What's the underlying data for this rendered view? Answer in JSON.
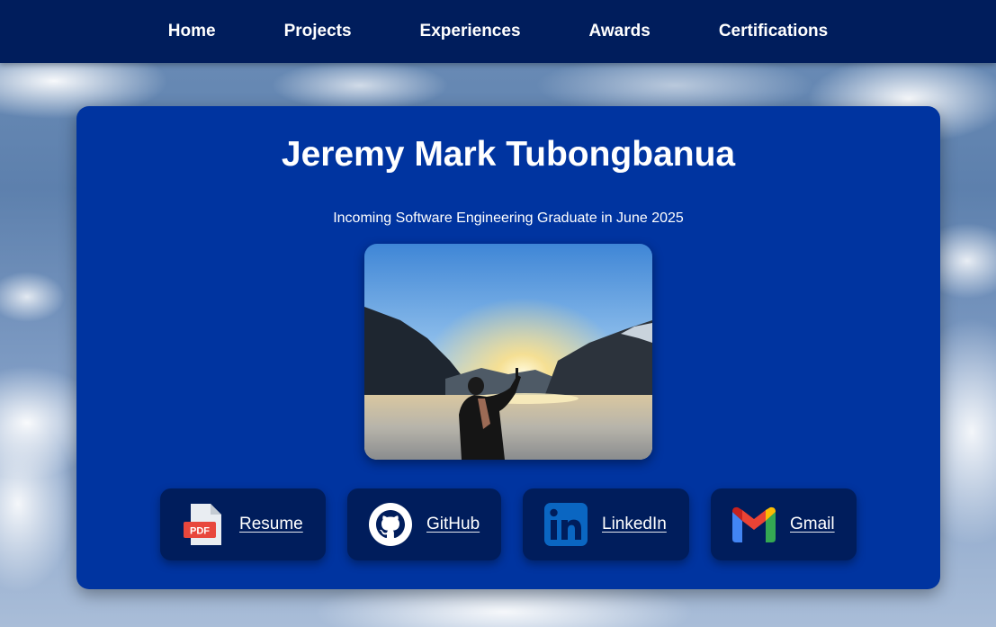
{
  "nav": {
    "items": [
      {
        "label": "Home"
      },
      {
        "label": "Projects"
      },
      {
        "label": "Experiences"
      },
      {
        "label": "Awards"
      },
      {
        "label": "Certifications"
      }
    ]
  },
  "profile": {
    "name": "Jeremy Mark Tubongbanua",
    "tagline": "Incoming Software Engineering Graduate in June 2025"
  },
  "links": [
    {
      "label": "Resume",
      "icon": "pdf-file-icon",
      "icon_text": "PDF"
    },
    {
      "label": "GitHub",
      "icon": "github-icon"
    },
    {
      "label": "LinkedIn",
      "icon": "linkedin-icon",
      "icon_text": "in"
    },
    {
      "label": "Gmail",
      "icon": "gmail-icon"
    }
  ],
  "colors": {
    "navbar": "#001d5c",
    "card": "#0034a0",
    "button": "#001d5c",
    "text": "#ffffff"
  }
}
